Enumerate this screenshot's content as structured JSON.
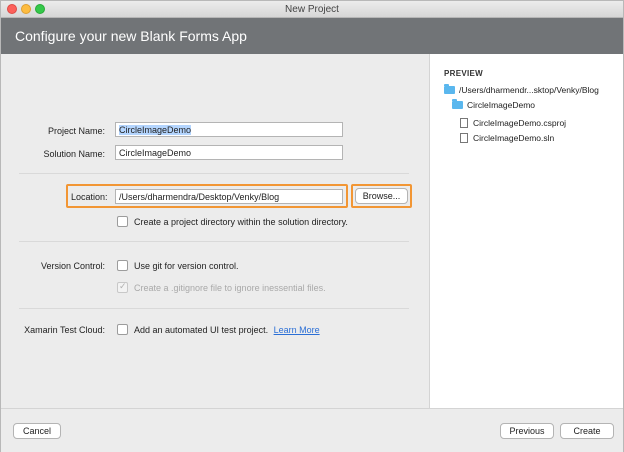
{
  "window": {
    "title": "New Project"
  },
  "header": {
    "title": "Configure your new Blank Forms App"
  },
  "form": {
    "project_name": {
      "label": "Project Name:",
      "value": "CircleImageDemo"
    },
    "solution_name": {
      "label": "Solution Name:",
      "value": "CircleImageDemo"
    },
    "location": {
      "label": "Location:",
      "value": "/Users/dharmendra/Desktop/Venky/Blog",
      "browse_label": "Browse..."
    },
    "create_dir": {
      "label": "Create a project directory within the solution directory.",
      "checked": false
    },
    "version_control": {
      "label": "Version Control:",
      "use_git": {
        "label": "Use git for version control.",
        "checked": false
      },
      "gitignore": {
        "label": "Create a .gitignore file to ignore inessential files.",
        "checked": true,
        "enabled": false
      }
    },
    "test_cloud": {
      "label": "Xamarin Test Cloud:",
      "option": {
        "label": "Add an automated UI test project.",
        "checked": false
      },
      "link": "Learn More"
    }
  },
  "preview": {
    "title": "PREVIEW",
    "root": "/Users/dharmendr...sktop/Venky/Blog",
    "folder": "CircleImageDemo",
    "files": [
      "CircleImageDemo.csproj",
      "CircleImageDemo.sln"
    ]
  },
  "footer": {
    "cancel": "Cancel",
    "previous": "Previous",
    "create": "Create"
  },
  "colors": {
    "highlight": "#f29634",
    "header_bg": "#717477",
    "folder": "#5ab7ee",
    "link": "#2b6fd6"
  }
}
